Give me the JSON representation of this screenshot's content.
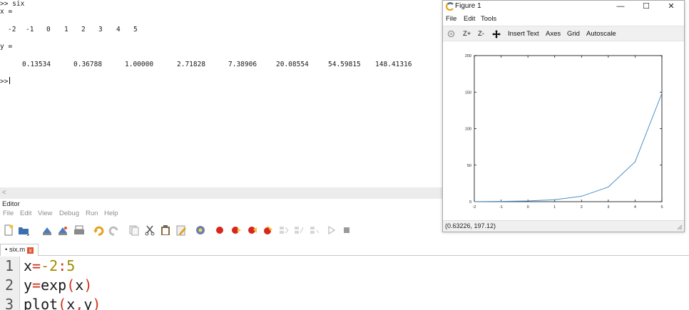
{
  "command_window": {
    "lines": [
      ">> six",
      "x ="
    ],
    "x_values": [
      "-2",
      "-1",
      "0",
      "1",
      "2",
      "3",
      "4",
      "5"
    ],
    "y_label": "y =",
    "y_values": [
      "0.13534",
      "0.36788",
      "1.00000",
      "2.71828",
      "7.38906",
      "20.08554",
      "54.59815",
      "148.41316"
    ],
    "prompt": ">>"
  },
  "editor": {
    "label": "Editor",
    "menu": [
      "File",
      "Edit",
      "View",
      "Debug",
      "Run",
      "Help"
    ],
    "tab": {
      "marker": "•",
      "name": "six.m",
      "close": "x"
    },
    "code_lines": [
      {
        "num": "1",
        "segments": [
          {
            "text": "x",
            "cls": "kw"
          },
          {
            "text": "=",
            "cls": "op"
          },
          {
            "text": "-2",
            "cls": "n"
          },
          {
            "text": ":",
            "cls": "op"
          },
          {
            "text": "5",
            "cls": "n"
          }
        ]
      },
      {
        "num": "2",
        "segments": [
          {
            "text": "y",
            "cls": "kw"
          },
          {
            "text": "=",
            "cls": "op"
          },
          {
            "text": "exp",
            "cls": "kw"
          },
          {
            "text": "(",
            "cls": "op"
          },
          {
            "text": "x",
            "cls": "kw"
          },
          {
            "text": ")",
            "cls": "op"
          }
        ]
      },
      {
        "num": "3",
        "segments": [
          {
            "text": "plot",
            "cls": "kw"
          },
          {
            "text": "(",
            "cls": "op"
          },
          {
            "text": "x",
            "cls": "kw"
          },
          {
            "text": ",",
            "cls": "op"
          },
          {
            "text": "y",
            "cls": "kw"
          },
          {
            "text": ")",
            "cls": "op"
          }
        ]
      }
    ]
  },
  "figure": {
    "title": "Figure 1",
    "window_buttons": {
      "minimize": "—",
      "maximize": "☐",
      "close": "✕"
    },
    "menu": [
      "File",
      "Edit",
      "Tools"
    ],
    "toolbar": [
      "Z+",
      "Z-",
      "Insert Text",
      "Axes",
      "Grid",
      "Autoscale"
    ],
    "status": "(0.63226, 197.12)",
    "colors": {
      "line": "#4a90c8",
      "axes": "#000000"
    }
  },
  "chart_data": {
    "type": "line",
    "x": [
      -2,
      -1,
      0,
      1,
      2,
      3,
      4,
      5
    ],
    "series": [
      {
        "values": [
          0.13534,
          0.36788,
          1.0,
          2.71828,
          7.38906,
          20.08554,
          54.59815,
          148.41316
        ]
      }
    ],
    "xticks": [
      "-2",
      "-1",
      "0",
      "1",
      "2",
      "3",
      "4",
      "5"
    ],
    "yticks": [
      "0",
      "50",
      "100",
      "150",
      "200"
    ],
    "xlim": [
      -2,
      5
    ],
    "ylim": [
      0,
      200
    ],
    "grid": false,
    "title": "",
    "xlabel": "",
    "ylabel": ""
  }
}
